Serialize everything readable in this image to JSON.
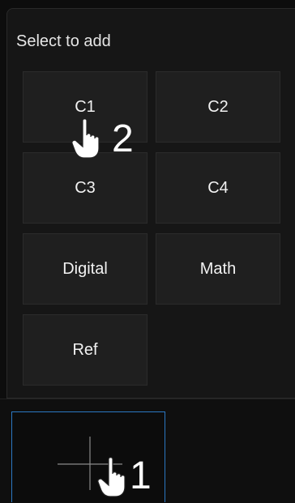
{
  "panel": {
    "title": "Select to add",
    "tiles": [
      {
        "label": "C1"
      },
      {
        "label": "C2"
      },
      {
        "label": "C3"
      },
      {
        "label": "C4"
      },
      {
        "label": "Digital"
      },
      {
        "label": "Math"
      },
      {
        "label": "Ref"
      }
    ]
  },
  "annotations": {
    "step1": "1",
    "step2": "2"
  },
  "colors": {
    "background": "#0d0d0d",
    "panel": "#161616",
    "tile": "#1f1f1f",
    "accent_border": "#2b78c2",
    "text": "#f2f2f2"
  },
  "icons": {
    "add_button": "plus-icon",
    "pointer": "hand-pointer-icon"
  }
}
